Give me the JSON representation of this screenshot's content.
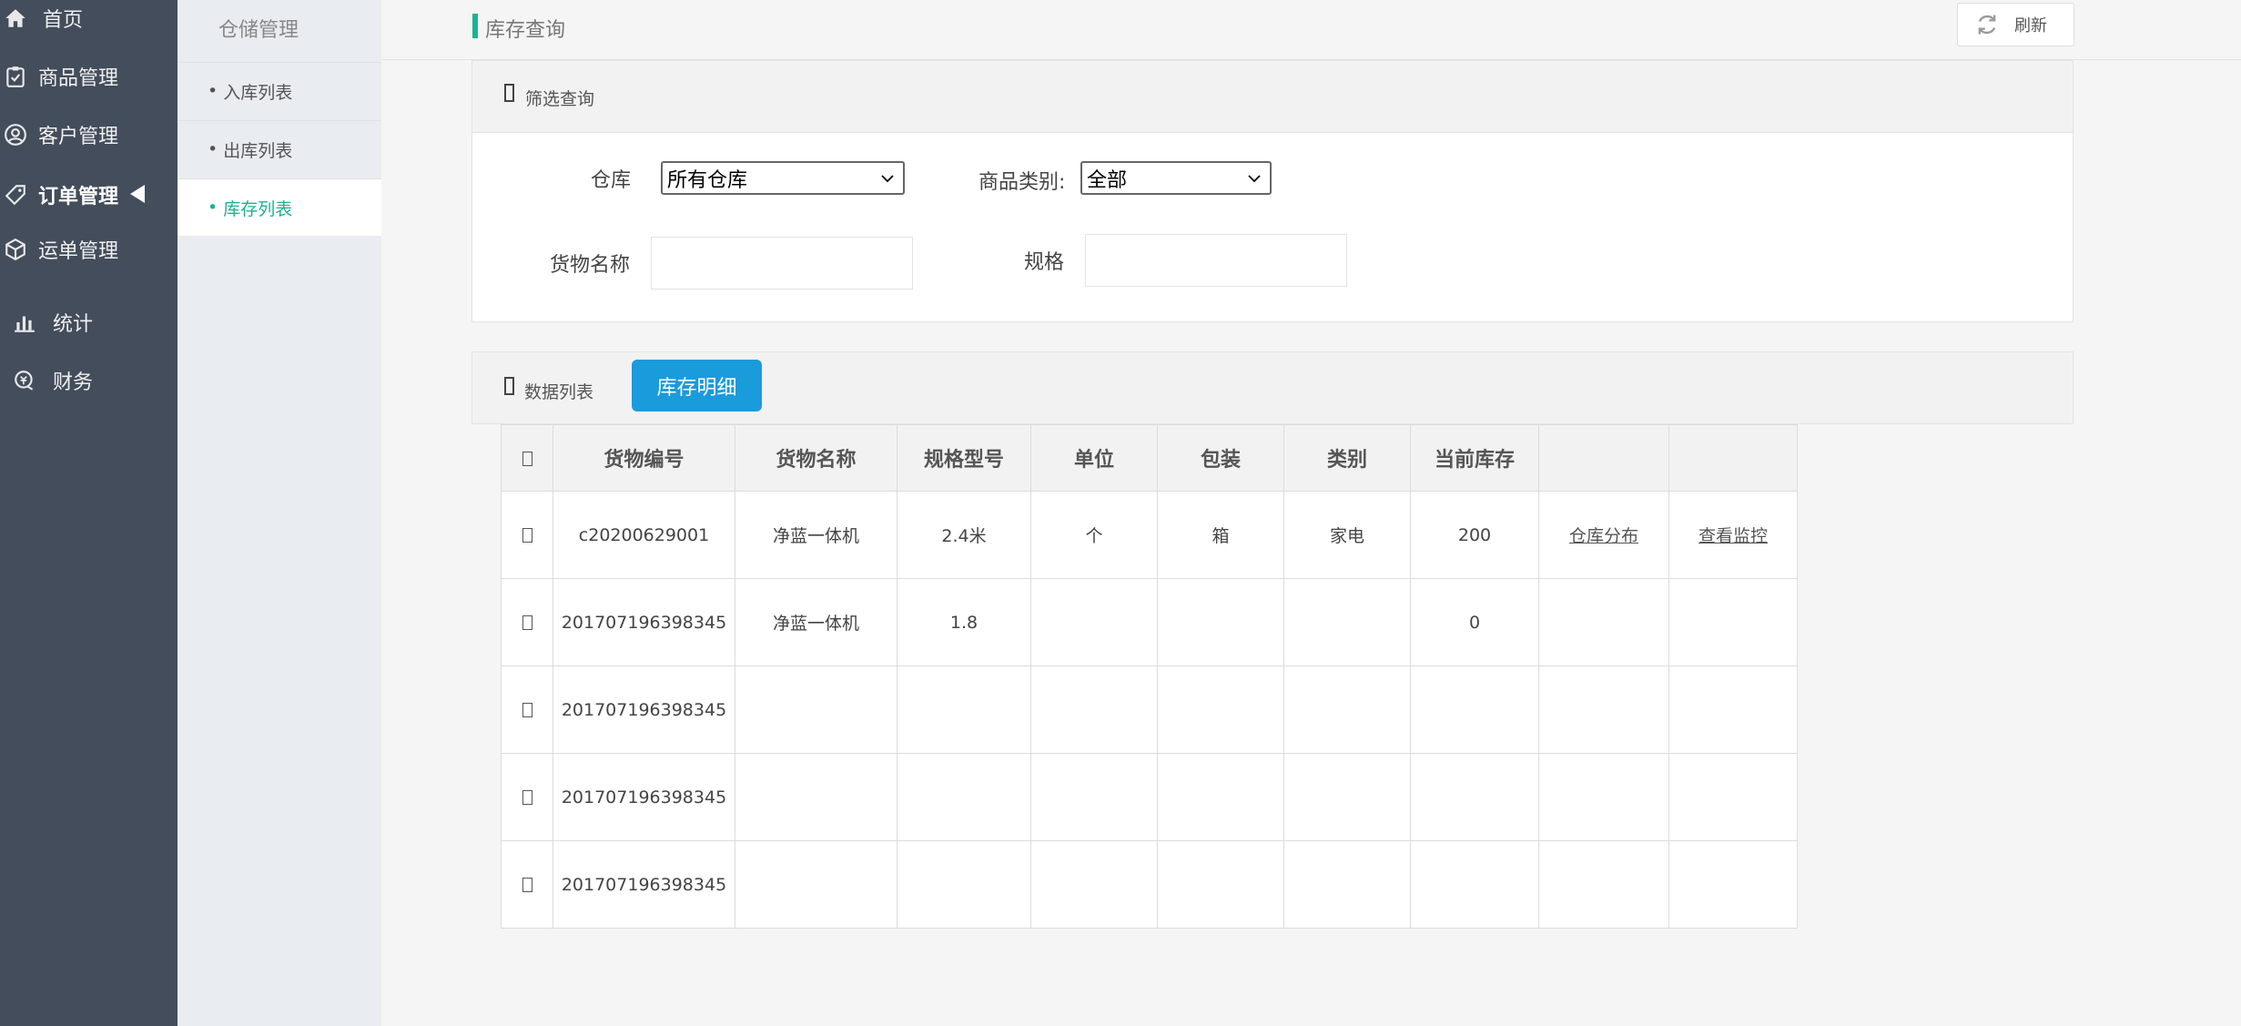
{
  "nav": {
    "items": [
      {
        "label": "首页",
        "icon": "home-icon"
      },
      {
        "label": "商品管理",
        "icon": "clipboard-check-icon"
      },
      {
        "label": "客户管理",
        "icon": "user-icon"
      },
      {
        "label": "订单管理",
        "icon": "tag-icon"
      },
      {
        "label": "运单管理",
        "icon": "box-icon"
      },
      {
        "label": "统计",
        "icon": "bar-chart-icon"
      },
      {
        "label": "财务",
        "icon": "finance-icon"
      }
    ]
  },
  "subnav": {
    "title": "仓储管理",
    "bullet": "•",
    "items": [
      {
        "label": "入库列表"
      },
      {
        "label": "出库列表"
      },
      {
        "label": "库存列表"
      }
    ]
  },
  "header": {
    "title": "库存查询",
    "refresh_label": "刷新"
  },
  "filter": {
    "section_label": "筛选查询",
    "warehouse_label": "仓库",
    "warehouse_value": "所有仓库",
    "category_label": "商品类别:",
    "category_value": "全部",
    "name_label": "货物名称",
    "name_value": "",
    "spec_label": "规格",
    "spec_value": ""
  },
  "list": {
    "section_label": "数据列表",
    "detail_button": "库存明细"
  },
  "table": {
    "headers": [
      "货物编号",
      "货物名称",
      "规格型号",
      "单位",
      "包装",
      "类别",
      "当前库存"
    ],
    "rows": [
      {
        "code": "c20200629001",
        "name": "净蓝一体机",
        "spec": "2.4米",
        "unit": "个",
        "pack": "箱",
        "category": "家电",
        "stock": "200",
        "action1": "仓库分布",
        "action2": "查看监控"
      },
      {
        "code": "201707196398345",
        "name": "净蓝一体机",
        "spec": "1.8",
        "unit": "",
        "pack": "",
        "category": "",
        "stock": "0",
        "action1": "",
        "action2": ""
      },
      {
        "code": "201707196398345",
        "name": "",
        "spec": "",
        "unit": "",
        "pack": "",
        "category": "",
        "stock": "",
        "action1": "",
        "action2": ""
      },
      {
        "code": "201707196398345",
        "name": "",
        "spec": "",
        "unit": "",
        "pack": "",
        "category": "",
        "stock": "",
        "action1": "",
        "action2": ""
      },
      {
        "code": "201707196398345",
        "name": "",
        "spec": "",
        "unit": "",
        "pack": "",
        "category": "",
        "stock": "",
        "action1": "",
        "action2": ""
      }
    ]
  },
  "colors": {
    "nav_bg": "#434d5b",
    "subnav_bg": "#e9ecf0",
    "accent_green": "#1ab394",
    "button_blue": "#1a9bdc"
  }
}
